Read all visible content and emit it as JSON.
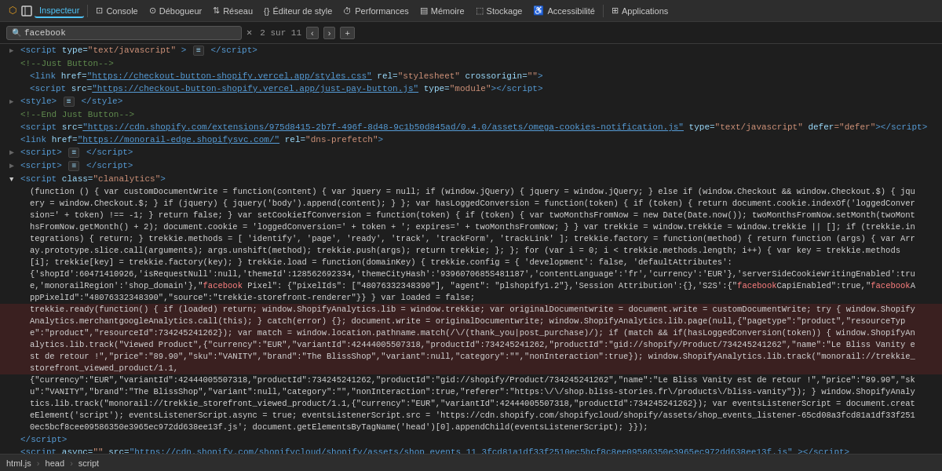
{
  "toolbar": {
    "logo": "⬡",
    "app_name": "Inspecteur",
    "items": [
      {
        "label": "Console",
        "icon": "⊡",
        "active": false
      },
      {
        "label": "Débogueur",
        "icon": "⊙",
        "active": false
      },
      {
        "label": "Réseau",
        "icon": "⇅",
        "active": false
      },
      {
        "label": "Éditeur de style",
        "icon": "{}",
        "active": false
      },
      {
        "label": "Performances",
        "icon": "⏱",
        "active": false
      },
      {
        "label": "Mémoire",
        "icon": "▤",
        "active": false
      },
      {
        "label": "Stockage",
        "icon": "⬚",
        "active": false
      },
      {
        "label": "Accessibilité",
        "icon": "♿",
        "active": false
      },
      {
        "label": "Applications",
        "icon": "⊞",
        "active": false
      }
    ]
  },
  "search": {
    "placeholder": "facebook",
    "value": "facebook",
    "count": "2 sur 11",
    "close_label": "✕",
    "prev_label": "‹",
    "next_label": "›",
    "add_label": "+"
  },
  "breadcrumb": {
    "items": [
      "html.js",
      "head",
      "script"
    ]
  },
  "code": {
    "lines": []
  }
}
